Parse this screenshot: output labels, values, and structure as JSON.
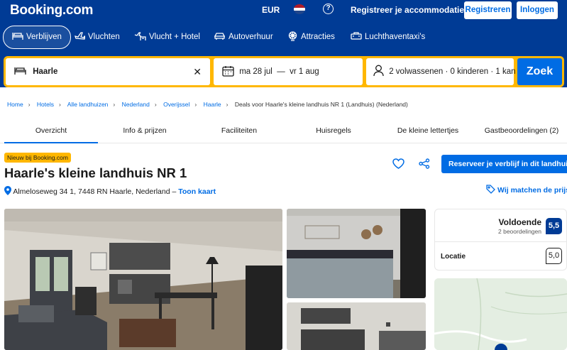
{
  "header": {
    "logo": "Booking.com",
    "currency": "EUR",
    "list_property": "Registreer je accommodatie",
    "register": "Registreren",
    "login": "Inloggen"
  },
  "nav": [
    {
      "label": "Verblijven",
      "icon": "bed-icon",
      "active": true
    },
    {
      "label": "Vluchten",
      "icon": "plane-icon"
    },
    {
      "label": "Vlucht + Hotel",
      "icon": "plane-hotel-icon"
    },
    {
      "label": "Autoverhuur",
      "icon": "car-icon"
    },
    {
      "label": "Attracties",
      "icon": "attractions-icon"
    },
    {
      "label": "Luchthaventaxi's",
      "icon": "taxi-icon"
    }
  ],
  "search": {
    "destination": "Haarle",
    "dates": "ma 28 jul  —  vr 1 aug",
    "guests": "2 volwassenen · 0 kinderen · 1 kan",
    "button": "Zoek"
  },
  "breadcrumbs": [
    "Home",
    "Hotels",
    "Alle landhuizen",
    "Nederland",
    "Overijssel",
    "Haarle"
  ],
  "breadcrumb_current": "Deals voor Haarle's kleine landhuis NR 1 (Landhuis) (Nederland)",
  "tabs": [
    "Overzicht",
    "Info & prijzen",
    "Faciliteiten",
    "Huisregels",
    "De kleine lettertjes",
    "Gastbeoordelingen (2)"
  ],
  "property": {
    "badge": "Nieuw bij Booking.com",
    "name": "Haarle's kleine landhuis NR 1",
    "address": "Almeloseweg 34 1, 7448 RN Haarle, Nederland – ",
    "map_link": "Toon kaart",
    "reserve": "Reserveer je verblijf in dit landhuis",
    "price_match": "Wij matchen de prijs"
  },
  "rating": {
    "word": "Voldoende",
    "count": "2 beoordelingen",
    "score": "5,5",
    "location_label": "Locatie",
    "location_score": "5,0"
  },
  "colors": {
    "brand": "#003b95",
    "accent": "#006ce4",
    "search_border": "#ffb700"
  }
}
